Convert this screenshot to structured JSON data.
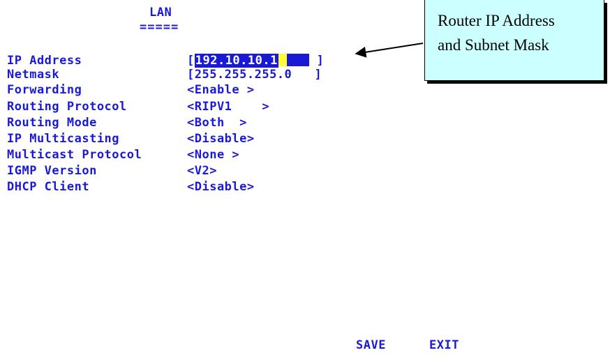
{
  "screen": {
    "title": "LAN",
    "title_underline": "====="
  },
  "fields": [
    {
      "label": "IP Address",
      "value": ""
    },
    {
      "label": "Netmask",
      "value": "[255.255.255.0   ]"
    },
    {
      "label": "Forwarding",
      "value": "<Enable >"
    },
    {
      "label": "Routing Protocol",
      "value": "<RIPV1    >"
    },
    {
      "label": "Routing Mode",
      "value": "<Both  >"
    },
    {
      "label": "IP Multicasting",
      "value": "<Disable>"
    },
    {
      "label": "Multicast Protocol",
      "value": "<None >"
    },
    {
      "label": "IGMP Version",
      "value": "<V2>"
    },
    {
      "label": "DHCP Client",
      "value": "<Disable>"
    }
  ],
  "ip_field": {
    "open": "[",
    "selected": "192.10.10.1",
    "close": "]"
  },
  "callout": {
    "line1": "Router IP Address",
    "line2": "and Subnet Mask"
  },
  "footer": {
    "save_label": "SAVE",
    "exit_label": "EXIT"
  },
  "colors": {
    "text": "#1a1ad6",
    "cursor": "#ffff33",
    "callout_bg": "#ccffff"
  }
}
